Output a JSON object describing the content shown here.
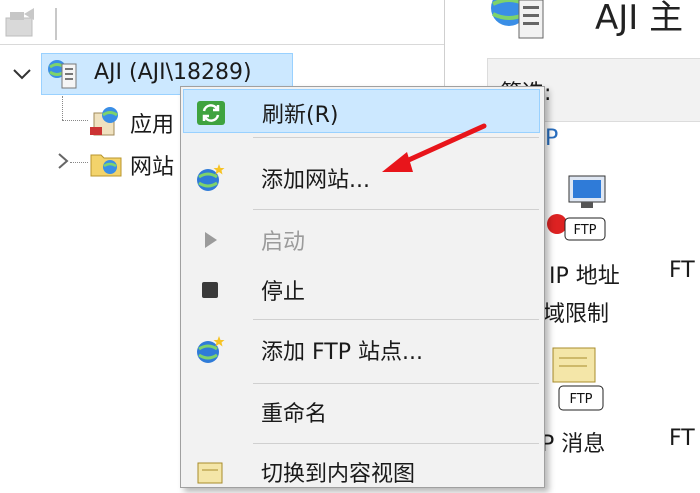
{
  "tree": {
    "root_label": "AJI (AJI\\18289)",
    "children": [
      {
        "label": "应用",
        "icon": "application-pools-icon"
      },
      {
        "label": "网站",
        "icon": "sites-folder-icon"
      }
    ]
  },
  "right_pane": {
    "title": "AJI 主",
    "filter_label": "筛选:",
    "features": [
      {
        "label": "IP 地址",
        "icon": "ftp-ip-restrictions-icon"
      },
      {
        "label": "FT"
      },
      {
        "label": "域限制"
      },
      {
        "label": "P 消息",
        "icon": "ftp-messages-icon"
      },
      {
        "label": "FT"
      }
    ],
    "section_letter": "P"
  },
  "context_menu": {
    "items": [
      {
        "label": "刷新(R)",
        "icon": "refresh-icon"
      },
      {
        "label": "添加网站...",
        "icon": "add-website-icon"
      },
      {
        "label": "启动",
        "icon": "start-icon",
        "disabled": true
      },
      {
        "label": "停止",
        "icon": "stop-icon"
      },
      {
        "label": "添加 FTP 站点...",
        "icon": "add-ftp-site-icon"
      },
      {
        "label": "重命名"
      },
      {
        "label": "切换到内容视图",
        "icon": "content-view-icon"
      }
    ]
  },
  "colors": {
    "selection_bg": "#cce8ff",
    "selection_border": "#99d1ff",
    "menu_bg": "#f2f2f2",
    "annotation_arrow": "#e8151b"
  }
}
